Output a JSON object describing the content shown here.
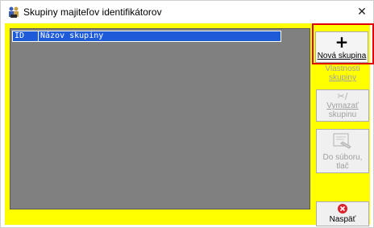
{
  "window": {
    "title": "Skupiny majiteľov identifikátorov",
    "close_glyph": "✕",
    "icon": "users-group-icon"
  },
  "list": {
    "columns": [
      "ID",
      "Názov skupiny"
    ],
    "rows": []
  },
  "buttons": {
    "new_group": {
      "label": "Nová skupina",
      "icon": "plus-icon",
      "glyph": "+",
      "enabled": true
    },
    "properties": {
      "label_line1": "Vlastnosti",
      "label_line2": "skupiny",
      "enabled": false
    },
    "delete": {
      "label_line1": "Vymazať",
      "label_line2": "skupinu",
      "icon": "scissors-icon",
      "glyph": "✂/",
      "enabled": false
    },
    "to_file": {
      "label": "Do súboru, tlač",
      "icon": "print-preview-icon",
      "enabled": false
    },
    "back": {
      "label": "Naspäť",
      "icon": "close-circle-icon",
      "enabled": true
    }
  },
  "colors": {
    "client_background": "#ffff00",
    "list_background": "#808080",
    "header_background": "#1e5bd8",
    "highlight": "#e00000",
    "back_icon": "#d9232d"
  }
}
